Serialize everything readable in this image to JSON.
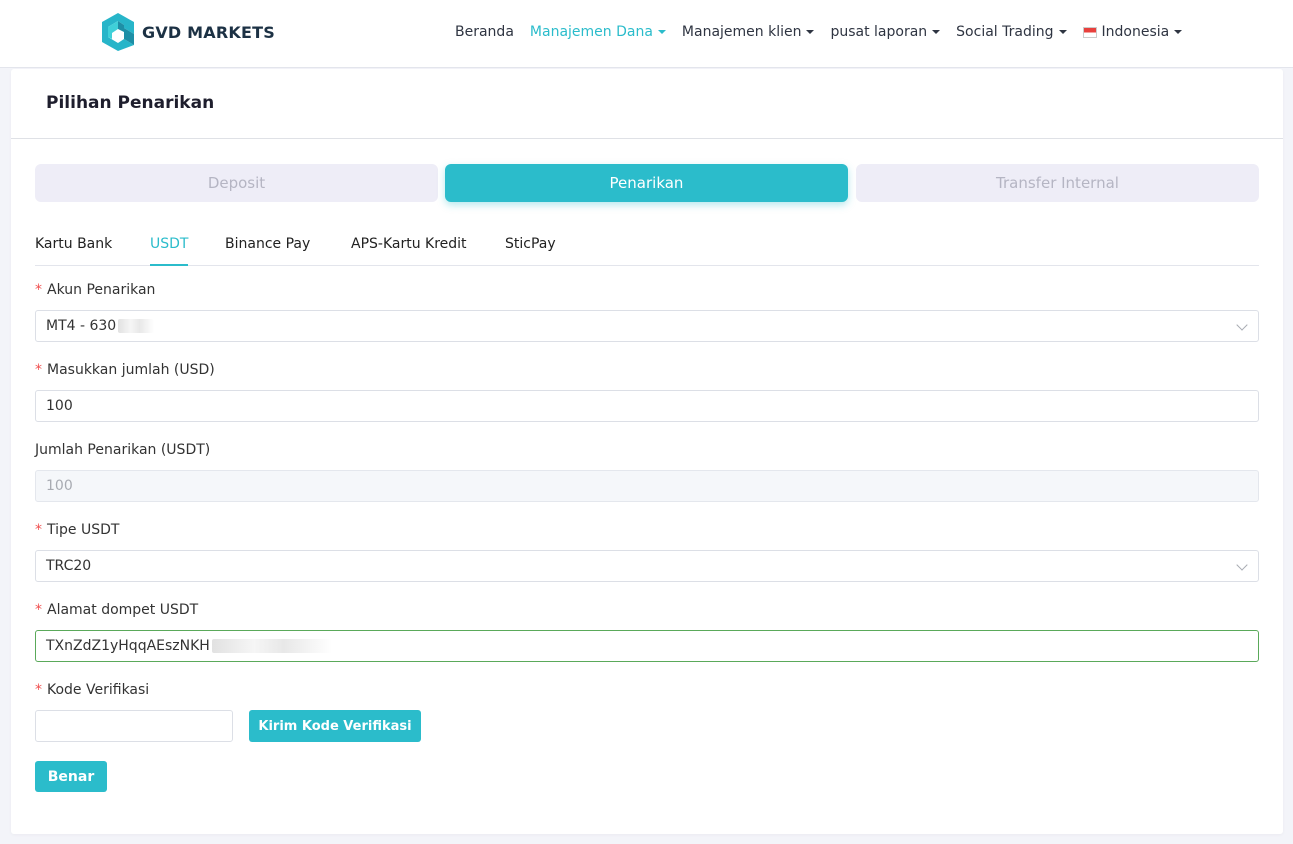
{
  "brand": {
    "name": "GVD MARKETS",
    "accent": "#2bbccb",
    "dark": "#1c3144"
  },
  "nav": {
    "items": [
      {
        "label": "Beranda",
        "dropdown": false,
        "active": false
      },
      {
        "label": "Manajemen Dana",
        "dropdown": true,
        "active": true
      },
      {
        "label": "Manajemen klien",
        "dropdown": true,
        "active": false
      },
      {
        "label": "pusat laporan",
        "dropdown": true,
        "active": false
      },
      {
        "label": "Social Trading",
        "dropdown": true,
        "active": false
      }
    ],
    "language": {
      "label": "Indonesia",
      "flag_icon": "indonesia-flag-icon"
    }
  },
  "page": {
    "title": "Pilihan Penarikan"
  },
  "type_buttons": [
    {
      "label": "Deposit",
      "active": false
    },
    {
      "label": "Penarikan",
      "active": true
    },
    {
      "label": "Transfer Internal",
      "active": false
    }
  ],
  "tabs": [
    {
      "label": "Kartu Bank",
      "active": false
    },
    {
      "label": "USDT",
      "active": true
    },
    {
      "label": "Binance Pay",
      "active": false
    },
    {
      "label": "APS-Kartu Kredit",
      "active": false
    },
    {
      "label": "SticPay",
      "active": false
    }
  ],
  "form": {
    "account": {
      "label": "Akun Penarikan",
      "required": true,
      "value": "MT4 - 630"
    },
    "amount": {
      "label": "Masukkan jumlah (USD)",
      "required": true,
      "value": "100"
    },
    "withdraw_amount": {
      "label": "Jumlah Penarikan (USDT)",
      "required": false,
      "value": "100",
      "disabled": true
    },
    "usdt_type": {
      "label": "Tipe USDT",
      "required": true,
      "value": "TRC20"
    },
    "wallet": {
      "label": "Alamat dompet USDT",
      "required": true,
      "value": "TXnZdZ1yHqqAEszNKH"
    },
    "code": {
      "label": "Kode Verifikasi",
      "required": true,
      "value": "",
      "send_button": "Kirim Kode Verifikasi"
    },
    "submit": "Benar"
  }
}
